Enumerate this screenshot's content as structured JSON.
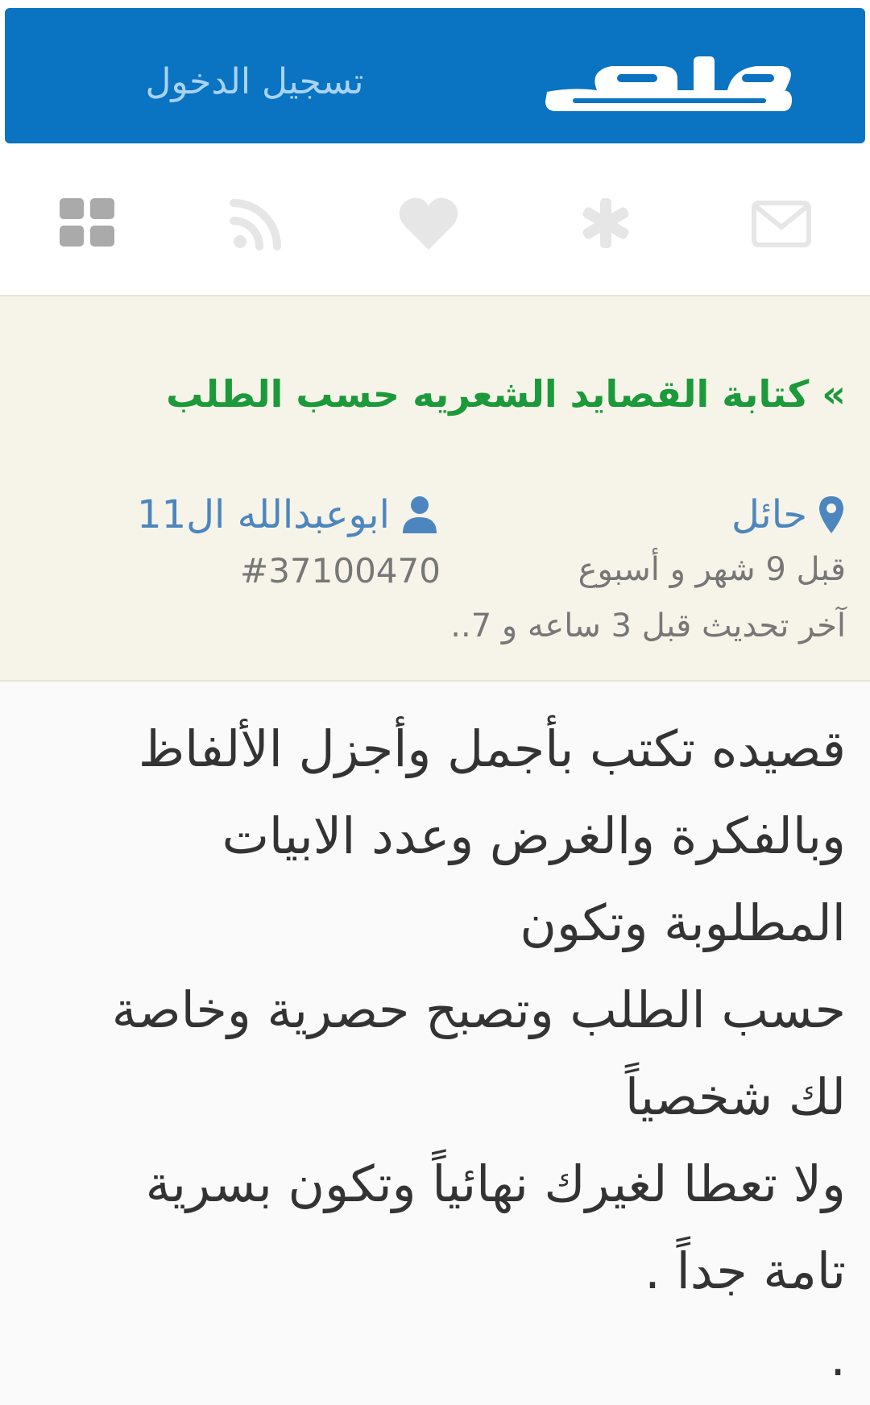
{
  "header": {
    "logo_alt": "حراج",
    "login_label": "تسجيل الدخول",
    "brand_color": "#0a73c2"
  },
  "nav_icons": [
    "apps-grid-icon",
    "rss-icon",
    "heart-icon",
    "asterisk-icon",
    "envelope-icon"
  ],
  "ad": {
    "title": "» كتابة القصايد الشعريه حسب الطلب",
    "city": "حائل",
    "user": "ابوعبدالله ال11",
    "id": "#37100470",
    "posted": "قبل 9 شهر و أسبوع",
    "updated": "آخر تحديث قبل 3 ساعه و 7..",
    "body": "قصيده تكتب بأجمل وأجزل الألفاظ\nوبالفكرة والغرض وعدد الابيات\nالمطلوبة وتكون\nحسب الطلب وتصبح حصرية وخاصة\nلك شخصياً\nولا تعطا لغيرك نهائياً وتكون بسرية\nتامة جداً .\n."
  }
}
